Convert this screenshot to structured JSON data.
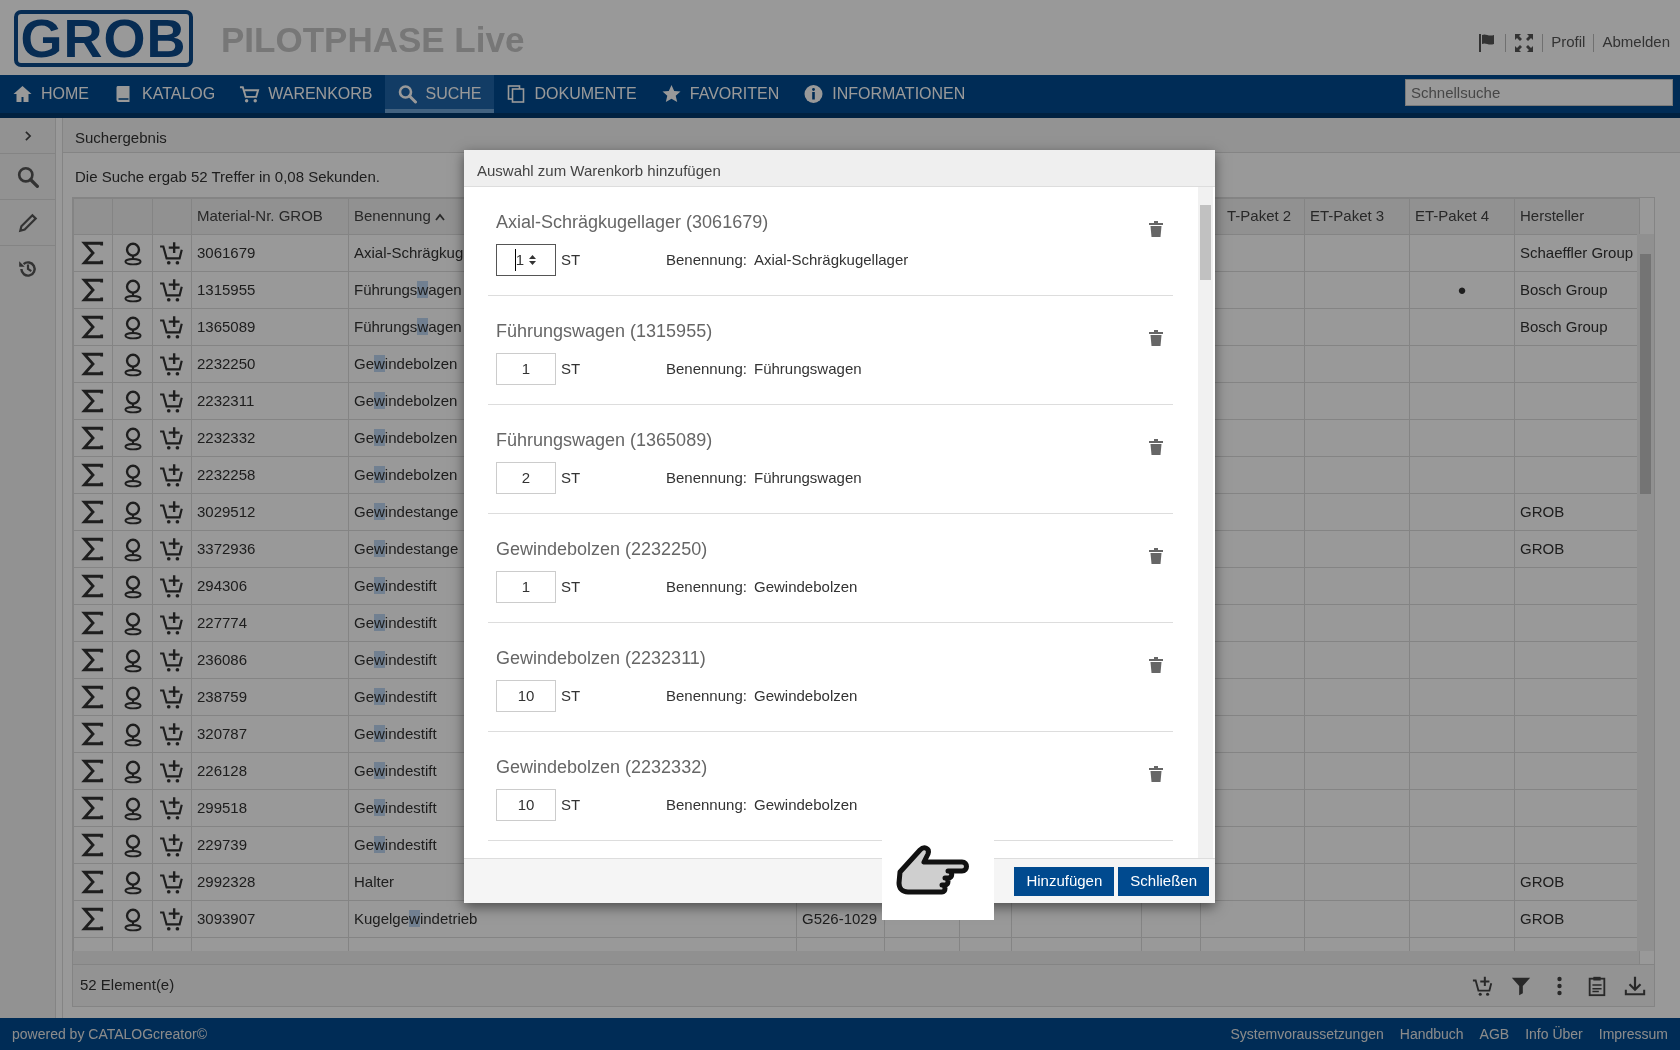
{
  "header": {
    "logo": "GROB",
    "title": "PILOTPHASE Live",
    "links": [
      "Profil",
      "Abmelden"
    ]
  },
  "nav": {
    "items": [
      {
        "label": "HOME",
        "selected": false
      },
      {
        "label": "KATALOG",
        "selected": false
      },
      {
        "label": "WARENKORB",
        "selected": false
      },
      {
        "label": "SUCHE",
        "selected": true
      },
      {
        "label": "DOKUMENTE",
        "selected": false
      },
      {
        "label": "FAVORITEN",
        "selected": false
      },
      {
        "label": "INFORMATIONEN",
        "selected": false
      }
    ],
    "search": {
      "placeholder": "Schnellsuche"
    }
  },
  "page": {
    "heading": "Suchergebnis",
    "summary": "Die Suche ergab 52 Treffer in 0,08 Sekunden."
  },
  "table": {
    "columns": [
      {
        "label": "Material-Nr. GROB",
        "sorted": false
      },
      {
        "label": "Benennung",
        "sorted": true
      },
      {
        "label": "T-Paket 2",
        "sorted": false
      },
      {
        "label": "ET-Paket 3",
        "sorted": false
      },
      {
        "label": "ET-Paket 4",
        "sorted": false
      },
      {
        "label": "Hersteller",
        "sorted": false
      }
    ],
    "rows": [
      {
        "material": "3061679",
        "name": [
          "Axial-Schrägkug"
        ],
        "hersteller": "Schaeffler Group"
      },
      {
        "material": "1315955",
        "name": [
          "Führungs",
          "w",
          "agen"
        ],
        "et_paket_4": "●",
        "hersteller": "Bosch Group"
      },
      {
        "material": "1365089",
        "name": [
          "Führungs",
          "w",
          "agen"
        ],
        "hersteller": "Bosch Group"
      },
      {
        "material": "2232250",
        "name": [
          "Ge",
          "w",
          "indebolzen"
        ]
      },
      {
        "material": "2232311",
        "name": [
          "Ge",
          "w",
          "indebolzen"
        ]
      },
      {
        "material": "2232332",
        "name": [
          "Ge",
          "w",
          "indebolzen"
        ]
      },
      {
        "material": "2232258",
        "name": [
          "Ge",
          "w",
          "indebolzen"
        ]
      },
      {
        "material": "3029512",
        "name": [
          "Ge",
          "w",
          "indestange"
        ],
        "hersteller": "GROB"
      },
      {
        "material": "3372936",
        "name": [
          "Ge",
          "w",
          "indestange"
        ],
        "hersteller": "GROB"
      },
      {
        "material": "294306",
        "name": [
          "Ge",
          "w",
          "indestift"
        ]
      },
      {
        "material": "227774",
        "name": [
          "Ge",
          "w",
          "indestift"
        ]
      },
      {
        "material": "236086",
        "name": [
          "Ge",
          "w",
          "indestift"
        ]
      },
      {
        "material": "238759",
        "name": [
          "Ge",
          "w",
          "indestift"
        ]
      },
      {
        "material": "320787",
        "name": [
          "Ge",
          "w",
          "indestift"
        ]
      },
      {
        "material": "226128",
        "name": [
          "Ge",
          "w",
          "indestift"
        ]
      },
      {
        "material": "299518",
        "name": [
          "Ge",
          "w",
          "indestift"
        ]
      },
      {
        "material": "229739",
        "name": [
          "Ge",
          "w",
          "indestift"
        ]
      },
      {
        "material": "2992328",
        "name": [
          "Halter"
        ],
        "hersteller": "GROB"
      },
      {
        "material": "3093907",
        "name": [
          "Kugelge",
          "w",
          "indetrieb"
        ],
        "column_6": "G526-1029",
        "hersteller": "GROB"
      }
    ],
    "count": "52 Element(e)"
  },
  "dialog": {
    "title": "Auswahl zum Warenkorb hinzufügen",
    "items": [
      {
        "title": "Axial-Schrägkugellager (3061679)",
        "quantity": "1",
        "unit": "ST",
        "label": "Benennung:",
        "value": "Axial-Schrägkugellager",
        "focused": true
      },
      {
        "title": "Führungswagen (1315955)",
        "quantity": "1",
        "unit": "ST",
        "label": "Benennung:",
        "value": "Führungswagen",
        "focused": false
      },
      {
        "title": "Führungswagen (1365089)",
        "quantity": "2",
        "unit": "ST",
        "label": "Benennung:",
        "value": "Führungswagen",
        "focused": false
      },
      {
        "title": "Gewindebolzen (2232250)",
        "quantity": "1",
        "unit": "ST",
        "label": "Benennung:",
        "value": "Gewindebolzen",
        "focused": false
      },
      {
        "title": "Gewindebolzen (2232311)",
        "quantity": "10",
        "unit": "ST",
        "label": "Benennung:",
        "value": "Gewindebolzen",
        "focused": false
      },
      {
        "title": "Gewindebolzen (2232332)",
        "quantity": "10",
        "unit": "ST",
        "label": "Benennung:",
        "value": "Gewindebolzen",
        "focused": false
      }
    ],
    "buttons": [
      "Hinzufügen",
      "Schließen"
    ]
  },
  "footer": {
    "powered_by": "powered by CATALOGcreator©",
    "links": [
      "Systemvoraussetzungen",
      "Handbuch",
      "AGB",
      "Info Über",
      "Impressum"
    ]
  }
}
